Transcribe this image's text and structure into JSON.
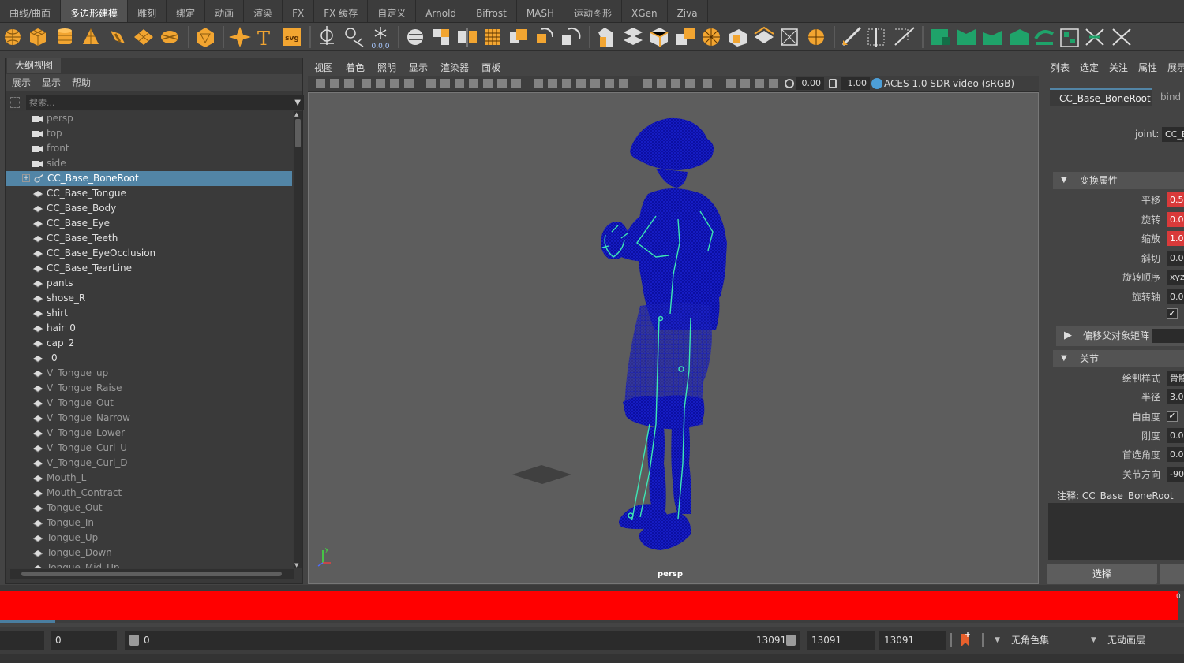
{
  "shelf_tabs": [
    "曲线/曲面",
    "多边形建模",
    "雕刻",
    "绑定",
    "动画",
    "渲染",
    "FX",
    "FX 缓存",
    "自定义",
    "Arnold",
    "Bifrost",
    "MASH",
    "运动图形",
    "XGen",
    "Ziva"
  ],
  "shelf_active_tab": "多边形建模",
  "shelf_icon_text": {
    "text_tool": "T",
    "svg_tool": "svg",
    "coords": "0,0,0"
  },
  "outliner": {
    "title": "大纲视图",
    "menu": [
      "展示",
      "显示",
      "帮助"
    ],
    "search_placeholder": "搜索...",
    "items": [
      {
        "label": "persp",
        "type": "camera",
        "dim": true
      },
      {
        "label": "top",
        "type": "camera",
        "dim": true
      },
      {
        "label": "front",
        "type": "camera",
        "dim": true
      },
      {
        "label": "side",
        "type": "camera",
        "dim": true
      },
      {
        "label": "CC_Base_BoneRoot",
        "type": "joint",
        "selected": true,
        "expandable": true
      },
      {
        "label": "CC_Base_Tongue",
        "type": "mesh"
      },
      {
        "label": "CC_Base_Body",
        "type": "mesh"
      },
      {
        "label": "CC_Base_Eye",
        "type": "mesh"
      },
      {
        "label": "CC_Base_Teeth",
        "type": "mesh"
      },
      {
        "label": "CC_Base_EyeOcclusion",
        "type": "mesh"
      },
      {
        "label": "CC_Base_TearLine",
        "type": "mesh"
      },
      {
        "label": "pants",
        "type": "mesh"
      },
      {
        "label": "shose_R",
        "type": "mesh"
      },
      {
        "label": "shirt",
        "type": "mesh"
      },
      {
        "label": "hair_0",
        "type": "mesh"
      },
      {
        "label": "cap_2",
        "type": "mesh"
      },
      {
        "label": "_0",
        "type": "mesh"
      },
      {
        "label": "V_Tongue_up",
        "type": "mesh",
        "dim": true
      },
      {
        "label": "V_Tongue_Raise",
        "type": "mesh",
        "dim": true
      },
      {
        "label": "V_Tongue_Out",
        "type": "mesh",
        "dim": true
      },
      {
        "label": "V_Tongue_Narrow",
        "type": "mesh",
        "dim": true
      },
      {
        "label": "V_Tongue_Lower",
        "type": "mesh",
        "dim": true
      },
      {
        "label": "V_Tongue_Curl_U",
        "type": "mesh",
        "dim": true
      },
      {
        "label": "V_Tongue_Curl_D",
        "type": "mesh",
        "dim": true
      },
      {
        "label": "Mouth_L",
        "type": "mesh",
        "dim": true
      },
      {
        "label": "Mouth_Contract",
        "type": "mesh",
        "dim": true
      },
      {
        "label": "Tongue_Out",
        "type": "mesh",
        "dim": true
      },
      {
        "label": "Tongue_In",
        "type": "mesh",
        "dim": true
      },
      {
        "label": "Tongue_Up",
        "type": "mesh",
        "dim": true
      },
      {
        "label": "Tongue_Down",
        "type": "mesh",
        "dim": true
      },
      {
        "label": "Tongue_Mid_Up",
        "type": "mesh",
        "dim": true
      }
    ]
  },
  "viewport": {
    "menu": [
      "视图",
      "着色",
      "照明",
      "显示",
      "渲染器",
      "面板"
    ],
    "exposure": "0.00",
    "gamma": "1.00",
    "color_management": "ACES 1.0 SDR-video (sRGB)",
    "camera_label": "persp",
    "wireframe_color": "#0a10b0",
    "joint_color": "#3de6b4"
  },
  "attribute_editor": {
    "tabs": [
      "列表",
      "选定",
      "关注",
      "属性",
      "展示"
    ],
    "node_tab": "CC_Base_BoneRoot",
    "node_tab2": "bind",
    "joint_label": "joint:",
    "joint_value": "CC_B",
    "transform_section": "变换属性",
    "rows": [
      {
        "label": "平移",
        "value": "0.5",
        "red": true
      },
      {
        "label": "旋转",
        "value": "0.0",
        "red": true
      },
      {
        "label": "缩放",
        "value": "1.0",
        "red": true
      },
      {
        "label": "斜切",
        "value": "0.0"
      },
      {
        "label": "旋转顺序",
        "value": "xyz"
      },
      {
        "label": "旋转轴",
        "value": "0.0"
      }
    ],
    "offset_section": "偏移父对象矩阵",
    "joint_section": "关节",
    "joint_rows": [
      {
        "label": "绘制样式",
        "value": "骨骼"
      },
      {
        "label": "半径",
        "value": "3.0"
      },
      {
        "label": "自由度",
        "value": "✓",
        "check": true
      },
      {
        "label": "刚度",
        "value": "0.0"
      },
      {
        "label": "首选角度",
        "value": "0.0"
      },
      {
        "label": "关节方向",
        "value": "-90"
      }
    ],
    "notes_label": "注释: CC_Base_BoneRoot",
    "select_button": "选择"
  },
  "timeline": {
    "color": "#ff0000",
    "start": "0",
    "range_start": "0",
    "range_end": "13091",
    "anim_end": "13091",
    "anim_end2": "13091",
    "char_set": "无角色集",
    "anim_layer": "无动画层",
    "edge_frame": "0"
  }
}
